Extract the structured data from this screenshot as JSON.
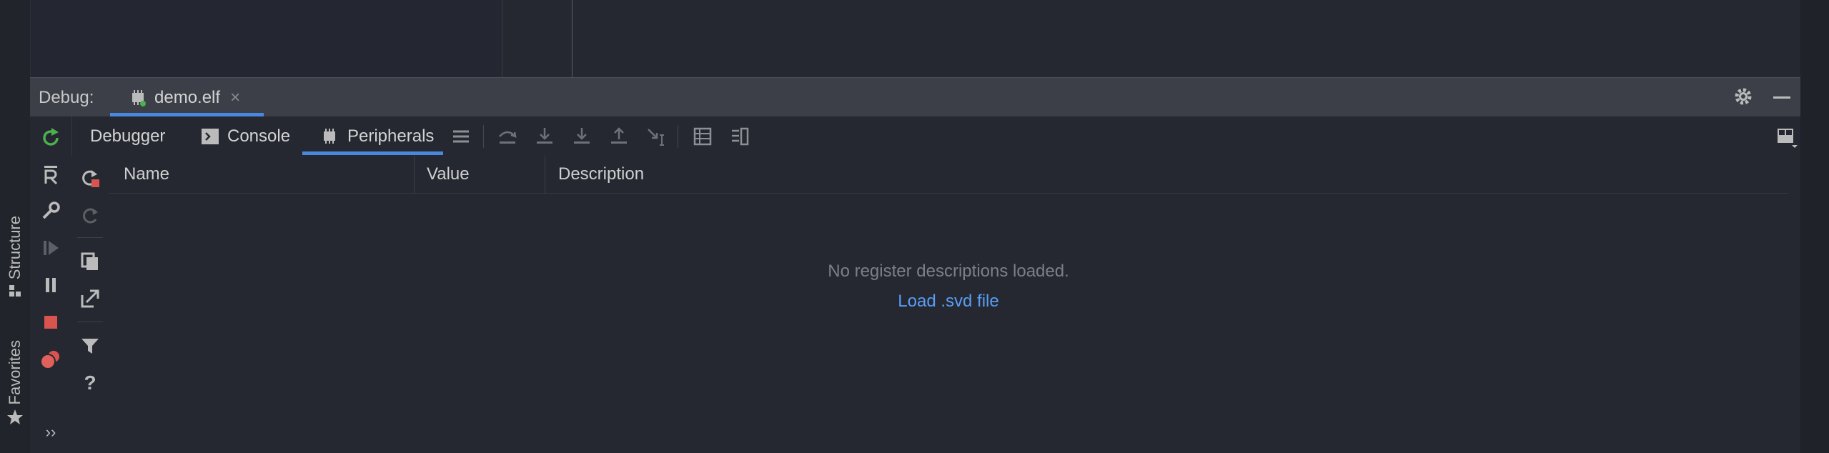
{
  "colors": {
    "accent": "#4a88e0",
    "link": "#589df6",
    "run_green": "#4caf50",
    "stop_red": "#d9534f"
  },
  "left_stripe": {
    "tabs": [
      {
        "label": "Structure",
        "icon": "structure-icon"
      },
      {
        "label": "Favorites",
        "icon": "star-icon"
      }
    ]
  },
  "debug": {
    "label": "Debug:",
    "session": {
      "name": "demo.elf",
      "icon": "chip-icon",
      "close": "×"
    }
  },
  "tabs": [
    {
      "label": "Debugger",
      "icon": null
    },
    {
      "label": "Console",
      "icon": "console-icon"
    },
    {
      "label": "Peripherals",
      "icon": "chip-icon",
      "active": true
    }
  ],
  "table": {
    "columns": [
      "Name",
      "Value",
      "Description"
    ],
    "empty_message": "No register descriptions loaded.",
    "load_link": "Load .svd file"
  },
  "side_toolbar": {
    "help": "?"
  },
  "more_chevron": "››"
}
